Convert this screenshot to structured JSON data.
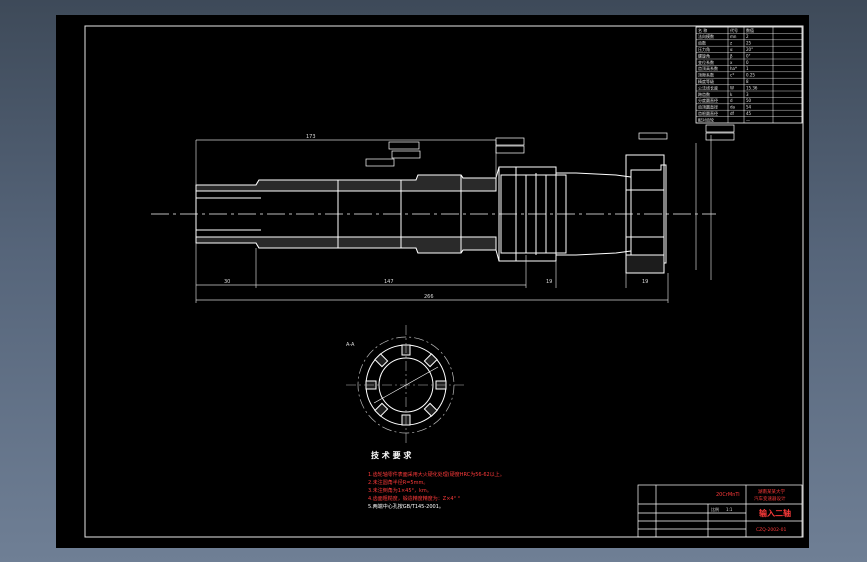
{
  "notes": {
    "heading": "技 术 要 求",
    "items": [
      "1.齿轮轴零件表面采用大火硬化处理(硬度HRC为56-62以上。",
      "2.未注圆角半径R=5mm。",
      "3.未注倒角为1×45°，km。",
      "4.齿面粗糙度，锻造精度精度为：Z×4° °",
      "5.两端中心孔按GB/T145-2001。"
    ]
  },
  "dimensions": {
    "overall": "266",
    "left_seg": "30",
    "mid_seg": "147",
    "seg_19a": "19",
    "seg_19b": "19",
    "top_len": "173",
    "section_label": "A-A",
    "scale_mark": "1:1"
  },
  "parameter_table": {
    "header": [
      "名 称",
      "代号",
      "数值"
    ],
    "rows": [
      [
        "法向模数",
        "mn",
        "2"
      ],
      [
        "齿数",
        "z",
        "25"
      ],
      [
        "压力角",
        "α",
        "20°"
      ],
      [
        "螺旋角",
        "β",
        "0°"
      ],
      [
        "变位系数",
        "x",
        "0"
      ],
      [
        "齿顶高系数",
        "ha*",
        "1"
      ],
      [
        "顶隙系数",
        "c*",
        "0.25"
      ],
      [
        "精度等级",
        "",
        "8"
      ],
      [
        "公法线长度",
        "W",
        "15.36"
      ],
      [
        "跨齿数",
        "k",
        "3"
      ],
      [
        "分度圆直径",
        "d",
        "50"
      ],
      [
        "齿顶圆直径",
        "da",
        "54"
      ],
      [
        "齿根圆直径",
        "df",
        "45"
      ],
      [
        "配对齿轮",
        "",
        "—"
      ]
    ]
  },
  "title_block": {
    "part_name": "输入二轴",
    "school": "湖南某某大学",
    "project": "汽车变速器设计",
    "material": "20CrMnTi",
    "drawing_no": "CZQ-2002-01",
    "scale_label": "比例",
    "scale_value": "1:1"
  },
  "colors": {
    "line": "#ffffff",
    "dim": "#cfcfcf",
    "note": "#ff3a3a",
    "border": "#e6e6e6"
  }
}
